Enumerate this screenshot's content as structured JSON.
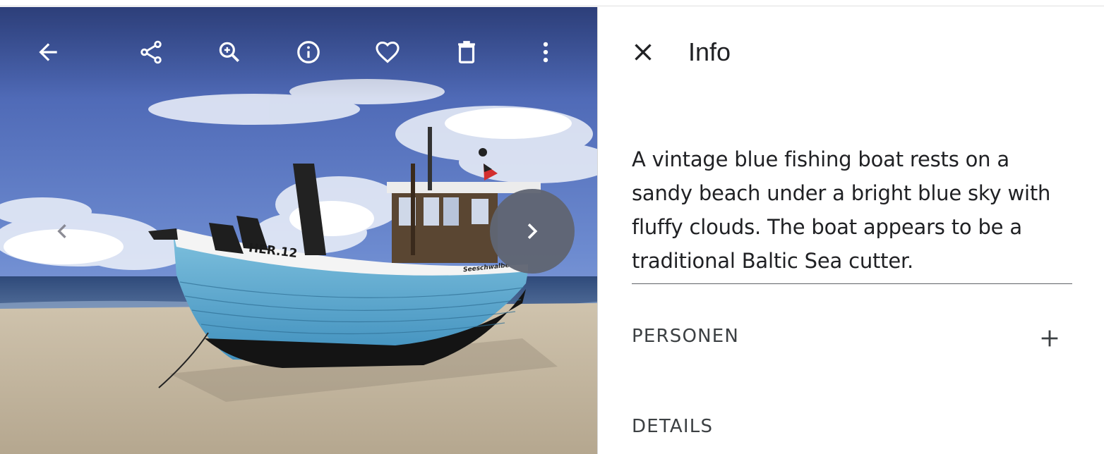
{
  "viewer": {
    "photo": {
      "boat_registration": "HER.12",
      "boat_name": "Seeschwalbe"
    },
    "toolbar": {
      "back_icon": "arrow-back-icon",
      "share_icon": "share-icon",
      "zoom_icon": "zoom-in-icon",
      "info_icon": "info-icon",
      "favorite_icon": "heart-icon",
      "delete_icon": "trash-icon",
      "more_icon": "more-vert-icon",
      "icon_color": "#ffffff"
    },
    "navigation": {
      "previous_icon": "chevron-left-icon",
      "next_icon": "chevron-right-icon"
    }
  },
  "info_panel": {
    "close_icon": "close-icon",
    "title": "Info",
    "description": "A vintage blue fishing boat rests on a sandy beach under a bright blue sky with fluffy clouds. The boat appears to be a traditional Baltic Sea cutter.",
    "sections": {
      "people": {
        "label": "PERSONEN",
        "add_icon": "plus-icon"
      },
      "details": {
        "label": "DETAILS"
      }
    }
  }
}
